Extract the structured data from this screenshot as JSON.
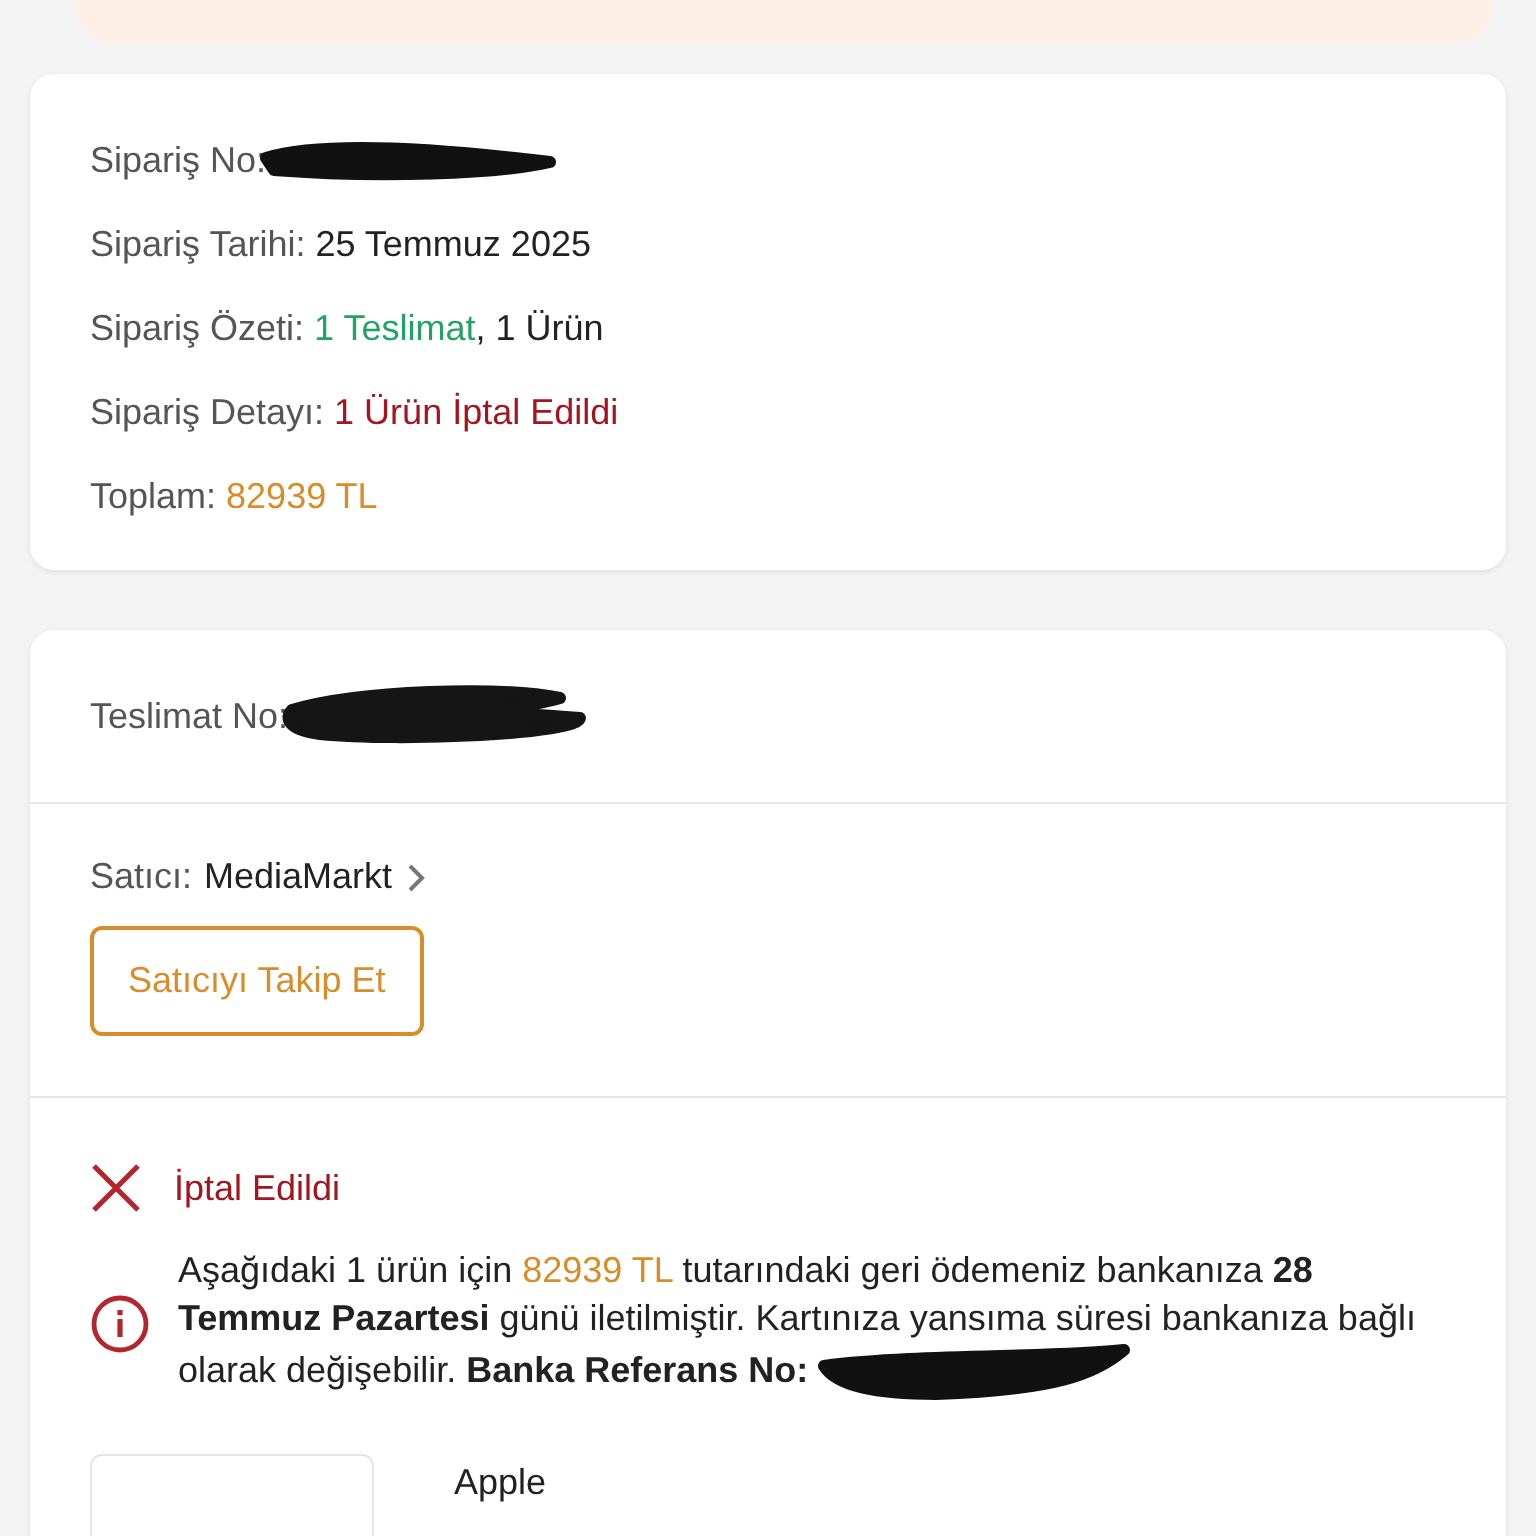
{
  "order_summary": {
    "fields": [
      {
        "label": "Sipariş No:",
        "redacted": true
      },
      {
        "label": "Sipariş Tarihi:",
        "redacted": false,
        "value": [
          {
            "text": "25 Temmuz 2025",
            "kind": "plain"
          }
        ]
      },
      {
        "label": "Sipariş Özeti:",
        "redacted": false,
        "value": [
          {
            "text": "1 Teslimat",
            "kind": "success"
          },
          {
            "text": ", 1 Ürün",
            "kind": "plain"
          }
        ]
      },
      {
        "label": "Sipariş Detayı:",
        "redacted": false,
        "value": [
          {
            "text": "1 Ürün İptal Edildi",
            "kind": "danger"
          }
        ]
      },
      {
        "label": "Toplam:",
        "redacted": false,
        "value": [
          {
            "text": "82939 TL",
            "kind": "amount"
          }
        ]
      }
    ]
  },
  "delivery": {
    "number_label": "Teslimat No:",
    "number_redacted": true,
    "seller_label": "Satıcı:",
    "seller_name": "MediaMarkt",
    "follow_button": "Satıcıyı Takip Et",
    "status": "İptal Edildi",
    "refund_note": [
      {
        "text": "Aşağıdaki 1 ürün için ",
        "kind": "plain"
      },
      {
        "text": "82939 TL",
        "kind": "amount"
      },
      {
        "text": " tutarındaki geri ödemeniz bankanıza ",
        "kind": "plain"
      },
      {
        "text": "28 Temmuz Pazartesi",
        "kind": "bold"
      },
      {
        "text": " günü iletilmiştir. Kartınıza yansıma süresi bankanıza bağlı olarak değişebilir. ",
        "kind": "plain"
      },
      {
        "text": "Banka Referans No:",
        "kind": "bold"
      }
    ],
    "refund_redacted": true,
    "product_brand": "Apple"
  }
}
